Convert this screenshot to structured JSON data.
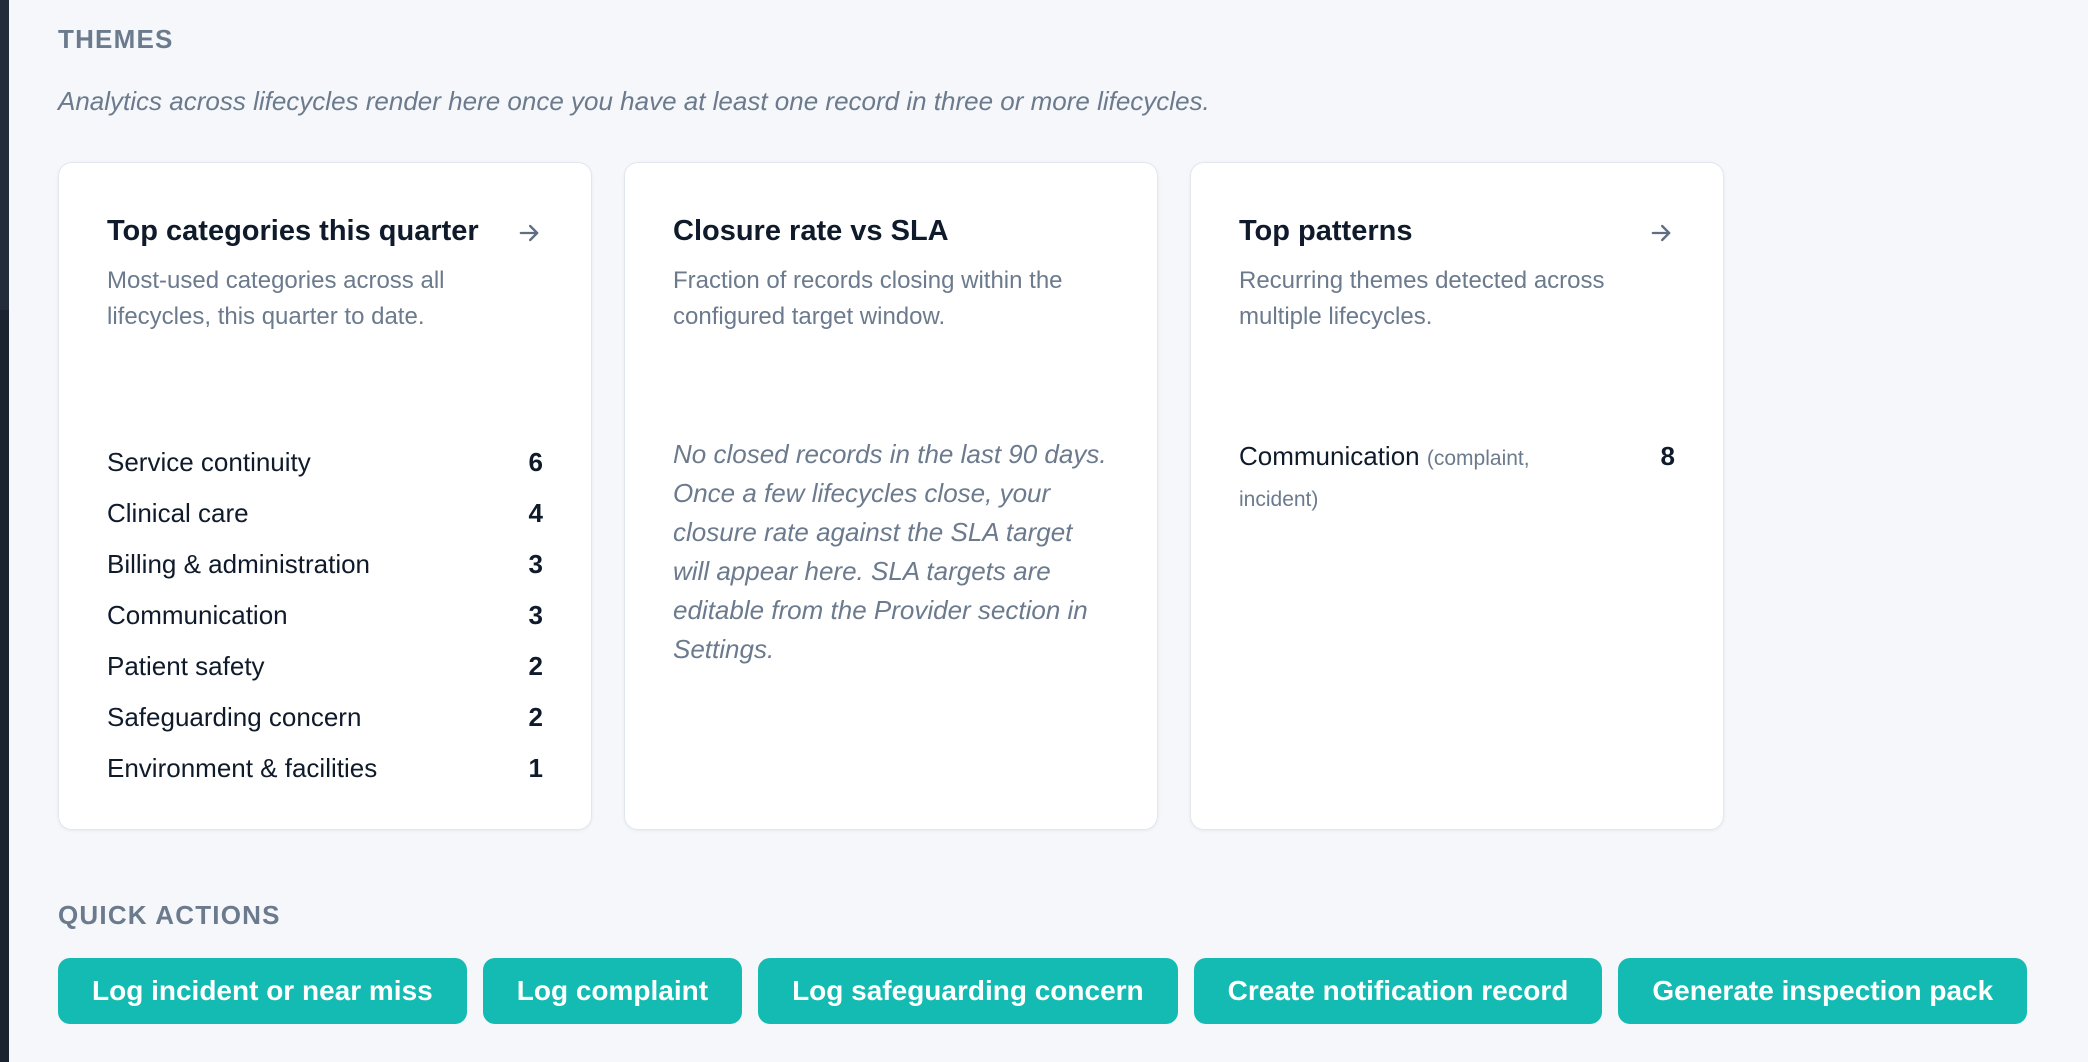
{
  "themes": {
    "title": "THEMES",
    "description": "Analytics across lifecycles render here once you have at least one record in three or more lifecycles."
  },
  "cards": {
    "top_categories": {
      "title": "Top categories this quarter",
      "description": "Most-used categories across all lifecycles, this quarter to date.",
      "arrow_icon": "arrow-right-icon",
      "items": [
        {
          "label": "Service continuity",
          "count": "6"
        },
        {
          "label": "Clinical care",
          "count": "4"
        },
        {
          "label": "Billing & administration",
          "count": "3"
        },
        {
          "label": "Communication",
          "count": "3"
        },
        {
          "label": "Patient safety",
          "count": "2"
        },
        {
          "label": "Safeguarding concern",
          "count": "2"
        },
        {
          "label": "Environment & facilities",
          "count": "1"
        }
      ]
    },
    "closure_rate": {
      "title": "Closure rate vs SLA",
      "description": "Fraction of records closing within the configured target window.",
      "empty_message": "No closed records in the last 90 days. Once a few lifecycles close, your closure rate against the SLA target will appear here. SLA targets are editable from the Provider section in Settings."
    },
    "top_patterns": {
      "title": "Top patterns",
      "description": "Recurring themes detected across multiple lifecycles.",
      "arrow_icon": "arrow-right-icon",
      "items": [
        {
          "label": "Communication",
          "lifecycles": "(complaint, incident)",
          "count": "8"
        }
      ]
    }
  },
  "quick_actions": {
    "title": "QUICK ACTIONS",
    "buttons": [
      "Log incident or near miss",
      "Log complaint",
      "Log safeguarding concern",
      "Create notification record",
      "Generate inspection pack"
    ]
  },
  "colors": {
    "accent": "#13bbb2",
    "muted_text": "#6b7a8d",
    "background": "#f5f7fa"
  }
}
